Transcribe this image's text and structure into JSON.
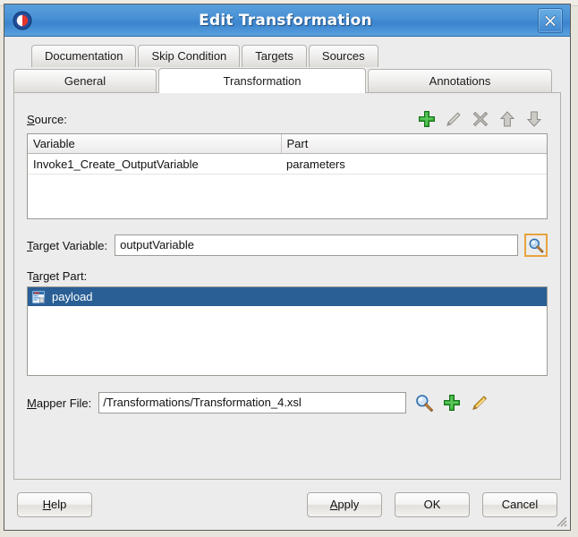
{
  "window": {
    "title": "Edit Transformation",
    "app_icon": "oracle-jdeveloper-icon",
    "close_label": "close-icon"
  },
  "tabs": {
    "row1": [
      {
        "label": "Documentation",
        "selected": false
      },
      {
        "label": "Skip Condition",
        "selected": false
      },
      {
        "label": "Targets",
        "selected": false
      },
      {
        "label": "Sources",
        "selected": false
      }
    ],
    "row2": [
      {
        "label": "General",
        "selected": false
      },
      {
        "label": "Transformation",
        "selected": true
      },
      {
        "label": "Annotations",
        "selected": false
      }
    ]
  },
  "source_section": {
    "label_mnemonic": "S",
    "label_rest": "ource:",
    "toolbar": [
      {
        "name": "add-icon",
        "enabled": true
      },
      {
        "name": "edit-pencil-icon",
        "enabled": false
      },
      {
        "name": "delete-icon",
        "enabled": false
      },
      {
        "name": "move-up-icon",
        "enabled": false
      },
      {
        "name": "move-down-icon",
        "enabled": false
      }
    ],
    "columns": [
      "Variable",
      "Part"
    ],
    "rows": [
      {
        "variable": "Invoke1_Create_OutputVariable",
        "part": "parameters"
      }
    ]
  },
  "target_variable": {
    "label_mnemonic": "T",
    "label_rest": "arget Variable:",
    "value": "outputVariable",
    "browse_icon": "search-magnifier-icon",
    "focus_color": "#e8a33d"
  },
  "target_part": {
    "label_prefix": "T",
    "label_mnemonic": "a",
    "label_rest": "rget Part:",
    "items": [
      {
        "label": "payload",
        "icon": "xml-document-icon",
        "selected": true
      }
    ],
    "selection_color": "#2a5f95"
  },
  "mapper_file": {
    "label_mnemonic": "M",
    "label_rest": "apper File:",
    "value": "/Transformations/Transformation_4.xsl",
    "actions": [
      {
        "name": "search-magnifier-icon"
      },
      {
        "name": "add-icon"
      },
      {
        "name": "edit-pencil-icon"
      }
    ]
  },
  "buttons": {
    "help": {
      "mnemonic": "H",
      "rest": "elp"
    },
    "apply": {
      "mnemonic": "A",
      "rest": "pply"
    },
    "ok": {
      "label": "OK"
    },
    "cancel": {
      "label": "Cancel"
    }
  },
  "colors": {
    "title_bar": "#4a92d6",
    "accent_green": "#2aa52a",
    "accent_orange": "#e8a33d",
    "selection_blue": "#2a5f95"
  }
}
